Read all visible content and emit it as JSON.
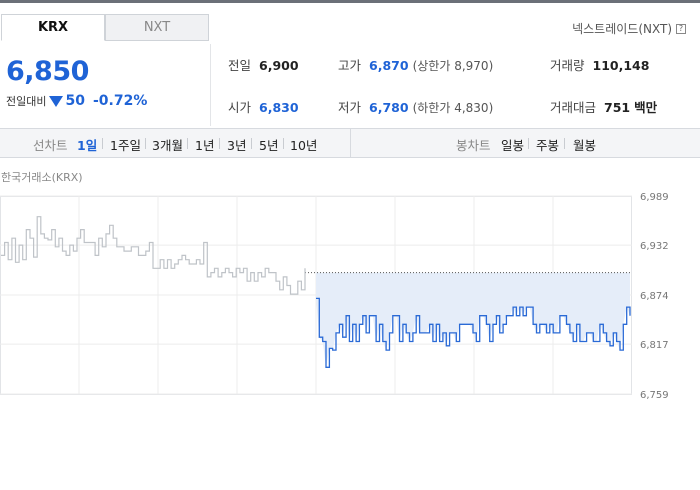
{
  "tabs": [
    {
      "label": "KRX",
      "active": true
    },
    {
      "label": "NXT",
      "active": false
    }
  ],
  "nxt_link": {
    "label": "넥스트레이드(NXT)",
    "icon": "help-icon"
  },
  "price": {
    "current": "6,850",
    "change_label": "전일대비",
    "change_icon": "down-triangle",
    "change_value": "50",
    "change_pct": "-0.72%"
  },
  "stats": {
    "prev_close": {
      "label": "전일",
      "value": "6,900"
    },
    "open": {
      "label": "시가",
      "value": "6,830"
    },
    "high": {
      "label": "고가",
      "value": "6,870",
      "limit_label": "상한가",
      "limit_value": "8,970"
    },
    "low": {
      "label": "저가",
      "value": "6,780",
      "limit_label": "하한가",
      "limit_value": "4,830"
    },
    "volume": {
      "label": "거래량",
      "value": "110,148"
    },
    "amount": {
      "label": "거래대금",
      "value": "751",
      "unit": "백만"
    }
  },
  "line_chart_periods": {
    "label": "선차트",
    "items": [
      "1일",
      "1주일",
      "3개월",
      "1년",
      "3년",
      "5년",
      "10년"
    ],
    "active": "1일"
  },
  "candle_chart_periods": {
    "label": "봉차트",
    "items": [
      "일봉",
      "주봉",
      "월봉"
    ]
  },
  "chart_caption": "한국거래소(KRX)",
  "colors": {
    "up_down_blue": "#1f63d6",
    "prev_line": "#bfc3c8",
    "today_line": "#2a6ad6",
    "fill": "#e5edf9"
  },
  "chart_data": {
    "type": "line",
    "title": "",
    "xlabel": "",
    "ylabel": "",
    "y_ticks": [
      "6,989",
      "6,932",
      "6,874",
      "6,817",
      "6,759"
    ],
    "ylim": [
      6759,
      6989
    ],
    "reference_line": {
      "label": "전일",
      "value": 6900
    },
    "grid": true,
    "series": [
      {
        "name": "",
        "color": "gray",
        "values": [
          6920,
          6935,
          6915,
          6940,
          6912,
          6932,
          6915,
          6950,
          6940,
          6918,
          6965,
          6945,
          6940,
          6938,
          6950,
          6930,
          6940,
          6925,
          6920,
          6932,
          6925,
          6940,
          6950,
          6935,
          6935,
          6935,
          6920,
          6940,
          6930,
          6945,
          6955,
          6940,
          6930,
          6930,
          6925,
          6925,
          6930,
          6930,
          6920,
          6920,
          6925,
          6935,
          6905,
          6905,
          6915,
          6905,
          6915,
          6905,
          6910,
          6915,
          6920,
          6915,
          6910,
          6910,
          6915,
          6910,
          6935,
          6895,
          6900,
          6905,
          6895,
          6900,
          6905,
          6900,
          6895,
          6905,
          6900,
          6905,
          6890,
          6900,
          6890,
          6900,
          6895,
          6905,
          6900,
          6900,
          6890,
          6880,
          6895,
          6885,
          6875,
          6875,
          6890,
          6880,
          6905
        ]
      },
      {
        "name": "",
        "color": "blue",
        "values": [
          6870,
          6825,
          6820,
          6790,
          6812,
          6810,
          6830,
          6840,
          6825,
          6850,
          6820,
          6840,
          6820,
          6840,
          6850,
          6830,
          6850,
          6850,
          6820,
          6840,
          6820,
          6810,
          6830,
          6850,
          6850,
          6820,
          6840,
          6830,
          6820,
          6830,
          6850,
          6830,
          6830,
          6830,
          6840,
          6820,
          6840,
          6820,
          6830,
          6815,
          6830,
          6830,
          6820,
          6840,
          6840,
          6840,
          6840,
          6830,
          6820,
          6850,
          6850,
          6840,
          6820,
          6840,
          6850,
          6830,
          6840,
          6850,
          6850,
          6860,
          6850,
          6860,
          6850,
          6860,
          6860,
          6840,
          6830,
          6840,
          6840,
          6830,
          6840,
          6830,
          6830,
          6850,
          6850,
          6840,
          6830,
          6820,
          6840,
          6820,
          6820,
          6830,
          6830,
          6820,
          6820,
          6840,
          6830,
          6820,
          6815,
          6830,
          6820,
          6810,
          6840,
          6860,
          6850
        ]
      }
    ]
  }
}
